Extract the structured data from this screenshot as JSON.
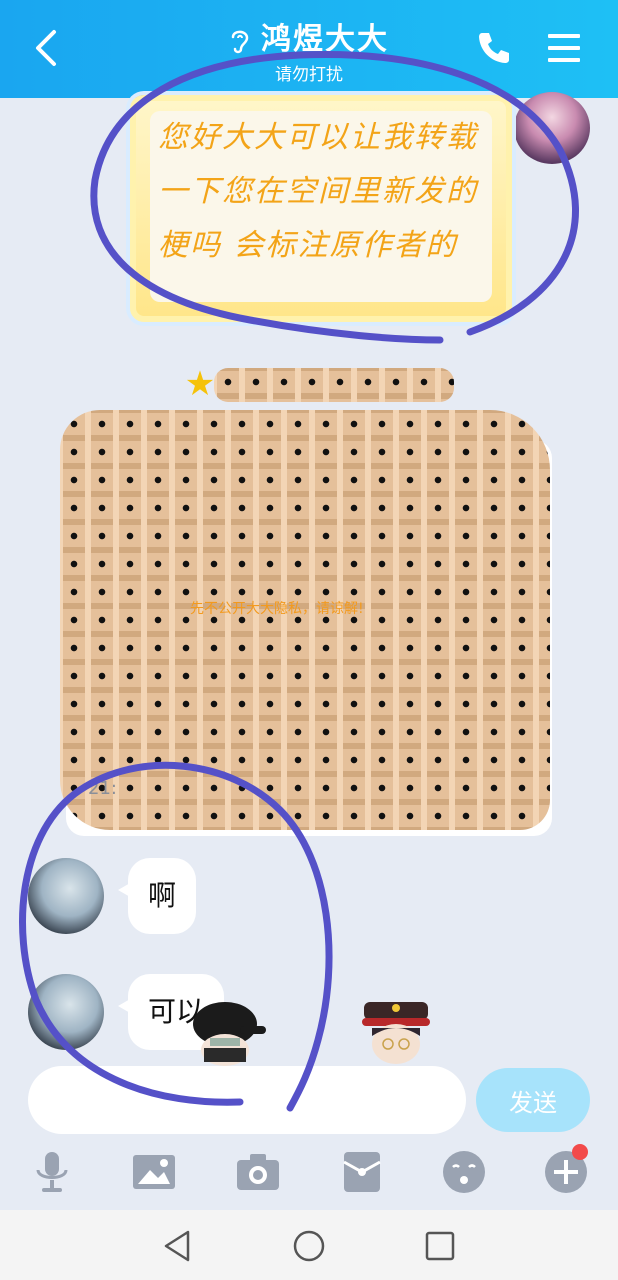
{
  "header": {
    "title": "鸿煜大大",
    "subtitle": "请勿打扰"
  },
  "messages": {
    "sticker_text": "您好大大可以让我转载一下您在空间里新发的梗吗 会标注原作者的",
    "card_caption": "先不公开大大隐私，请谅解!",
    "card_time": "21:",
    "reply1": "啊",
    "reply2": "可以"
  },
  "composer": {
    "input_value": "",
    "input_placeholder": "",
    "send_label": "发送"
  },
  "toolbar": {
    "icons": [
      "microphone-icon",
      "image-icon",
      "camera-icon",
      "red-packet-icon",
      "emoji-icon",
      "plus-icon"
    ],
    "has_notification_dot": true
  },
  "navbar": {
    "icons": [
      "back-triangle-icon",
      "home-circle-icon",
      "recents-square-icon"
    ]
  },
  "colors": {
    "header": "#1aa6f0",
    "background": "#e6ebf4",
    "send_button": "#a7e3fb",
    "sticker_text": "#f3a418",
    "scribble": "#5551c8",
    "notification": "#f24a4a"
  }
}
